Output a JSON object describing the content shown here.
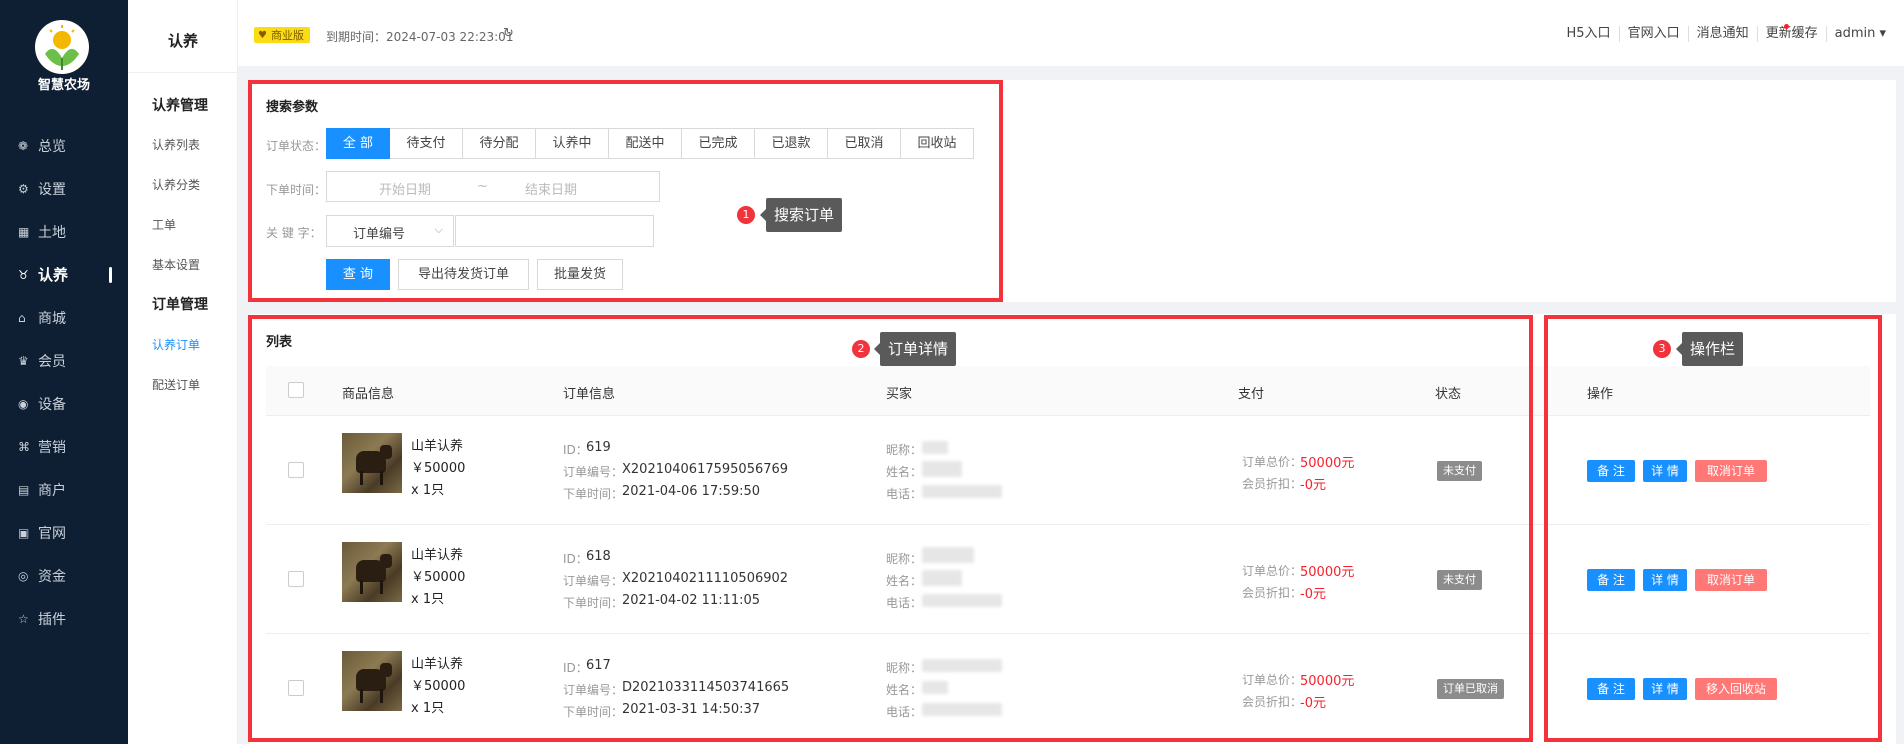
{
  "sidebar": {
    "logo_text": "智慧农场",
    "items": [
      {
        "label": "总览",
        "icon": "dashboard-icon"
      },
      {
        "label": "设置",
        "icon": "gear-icon"
      },
      {
        "label": "土地",
        "icon": "grid-icon"
      },
      {
        "label": "认养",
        "icon": "adopt-icon",
        "active": true
      },
      {
        "label": "商城",
        "icon": "shop-icon"
      },
      {
        "label": "会员",
        "icon": "member-icon"
      },
      {
        "label": "设备",
        "icon": "device-icon"
      },
      {
        "label": "营销",
        "icon": "marketing-icon"
      },
      {
        "label": "商户",
        "icon": "merchant-icon"
      },
      {
        "label": "官网",
        "icon": "website-icon"
      },
      {
        "label": "资金",
        "icon": "fund-icon"
      },
      {
        "label": "插件",
        "icon": "star-icon"
      }
    ]
  },
  "submenu": {
    "title": "认养",
    "group1": "认养管理",
    "items1": [
      "认养列表",
      "认养分类",
      "工单",
      "基本设置"
    ],
    "group2": "订单管理",
    "items2": [
      "认养订单",
      "配送订单"
    ]
  },
  "header": {
    "badge": "商业版",
    "expire": "到期时间：2024-07-03 22:23:01",
    "links": [
      "H5入口",
      "官网入口",
      "消息通知",
      "更新缓存",
      "admin ▾"
    ]
  },
  "search": {
    "title": "搜索参数",
    "status_label": "订单状态：",
    "statuses": [
      "全 部",
      "待支付",
      "待分配",
      "认养中",
      "配送中",
      "已完成",
      "已退款",
      "已取消",
      "回收站"
    ],
    "time_label": "下单时间：",
    "start_placeholder": "开始日期",
    "range_sep": "~",
    "end_placeholder": "结束日期",
    "keyword_label": "关 键 字：",
    "keyword_type": "订单编号",
    "keyword_value": "",
    "query_btn": "查 询",
    "export_btn": "导出待发货订单",
    "batch_btn": "批量发货"
  },
  "list": {
    "title": "列表",
    "columns": {
      "product": "商品信息",
      "order": "订单信息",
      "buyer": "买家",
      "pay": "支付",
      "status": "状态",
      "action": "操作"
    },
    "rows": [
      {
        "product_name": "山羊认养",
        "price": "￥50000",
        "qty": "x 1只",
        "id_label": "ID：",
        "id": "619",
        "no_label": "订单编号：",
        "no": "X2021040617595056769",
        "time_label": "下单时间：",
        "time": "2021-04-06 17:59:50",
        "nick_label": "昵称：",
        "name_label": "姓名：",
        "phone_label": "电话：",
        "total_label": "订单总价：",
        "total": "50000元",
        "discount_label": "会员折扣：",
        "discount": "-0元",
        "status": "未支付",
        "actions": [
          "备 注",
          "详 情",
          "取消订单"
        ]
      },
      {
        "product_name": "山羊认养",
        "price": "￥50000",
        "qty": "x 1只",
        "id_label": "ID：",
        "id": "618",
        "no_label": "订单编号：",
        "no": "X2021040211110506902",
        "time_label": "下单时间：",
        "time": "2021-04-02 11:11:05",
        "nick_label": "昵称：",
        "name_label": "姓名：",
        "phone_label": "电话：",
        "total_label": "订单总价：",
        "total": "50000元",
        "discount_label": "会员折扣：",
        "discount": "-0元",
        "status": "未支付",
        "actions": [
          "备 注",
          "详 情",
          "取消订单"
        ]
      },
      {
        "product_name": "山羊认养",
        "price": "￥50000",
        "qty": "x 1只",
        "id_label": "ID：",
        "id": "617",
        "no_label": "订单编号：",
        "no": "D2021033114503741665",
        "time_label": "下单时间：",
        "time": "2021-03-31 14:50:37",
        "nick_label": "昵称：",
        "name_label": "姓名：",
        "phone_label": "电话：",
        "total_label": "订单总价：",
        "total": "50000元",
        "discount_label": "会员折扣：",
        "discount": "-0元",
        "status": "订单已取消",
        "actions": [
          "备 注",
          "详 情",
          "移入回收站"
        ]
      }
    ]
  },
  "annotations": [
    {
      "num": "1",
      "text": "搜索订单"
    },
    {
      "num": "2",
      "text": "订单详情"
    },
    {
      "num": "3",
      "text": "操作栏"
    }
  ],
  "colors": {
    "primary": "#1890ff",
    "sidebar": "#0f1f33",
    "annotation": "#f2333b",
    "danger": "#ff7875"
  }
}
